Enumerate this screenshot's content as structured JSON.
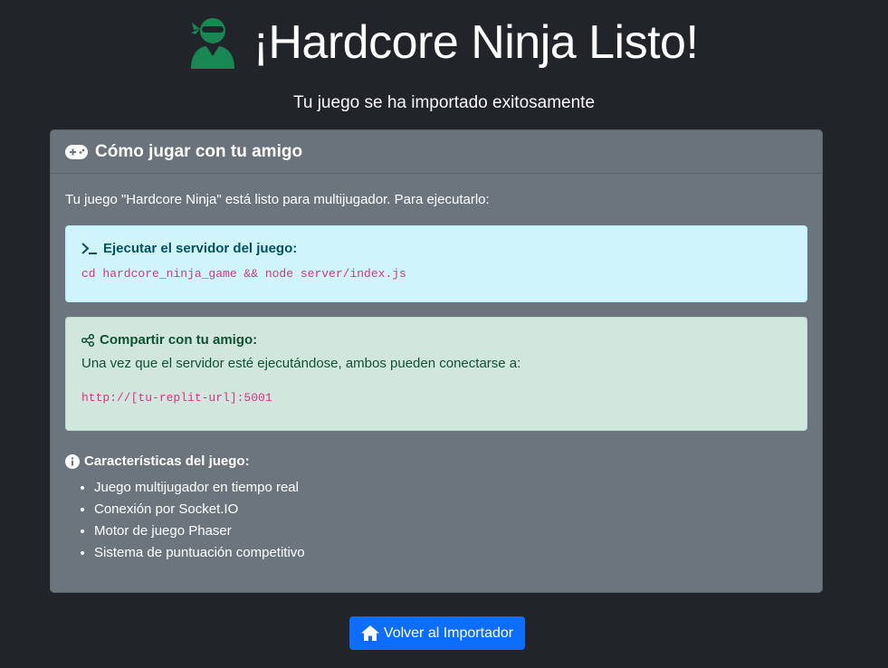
{
  "hero": {
    "title": "¡Hardcore Ninja Listo!",
    "subtitle": "Tu juego se ha importado exitosamente",
    "icon": "user-ninja-icon",
    "icon_color": "#198754"
  },
  "card": {
    "header_title": "Cómo jugar con tu amigo",
    "header_icon": "gamepad-icon",
    "intro": "Tu juego \"Hardcore Ninja\" está listo para multijugador. Para ejecutarlo:",
    "run_server": {
      "icon": "terminal-icon",
      "title": "Ejecutar el servidor del juego:",
      "command": "cd hardcore_ninja_game && node server/index.js"
    },
    "share": {
      "icon": "share-icon",
      "title": "Compartir con tu amigo:",
      "text": "Una vez que el servidor esté ejecutándose, ambos pueden conectarse a:",
      "url": "http://[tu-replit-url]:5001"
    },
    "features": {
      "icon": "info-circle-icon",
      "title": "Características del juego:",
      "items": [
        "Juego multijugador en tiempo real",
        "Conexión por Socket.IO",
        "Motor de juego Phaser",
        "Sistema de puntuación competitivo"
      ]
    }
  },
  "back_button": {
    "icon": "home-icon",
    "label": "Volver al Importador"
  },
  "colors": {
    "background": "#212529",
    "card": "#6c757d",
    "info_alert": "#cff4fc",
    "success_alert": "#d1e7dd",
    "code": "#d63384",
    "primary": "#0d6efd"
  }
}
